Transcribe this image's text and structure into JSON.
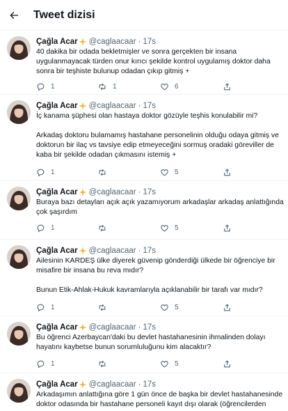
{
  "header": {
    "title": "Tweet dizisi",
    "back_icon": "arrow-left-icon"
  },
  "author": {
    "name": "Çağla Acar",
    "badge": "✨",
    "handle": "@caglaacaar",
    "separator": "·",
    "time": "17s"
  },
  "tweets": [
    {
      "lines": [
        "40 dakika bir odada bekletmişler ve sonra gerçekten bir insana",
        "uygulanmayacak türden onur kırıcı şekilde kontrol uygulamış doktor daha",
        "sonra bir teşhiste bulunup odadan çıkıp gitmiş +"
      ],
      "reply_count": "1",
      "retweet_count": "1",
      "like_count": "6"
    },
    {
      "lines": [
        "İç kanama şüphesi olan hastaya doktor gözüyle teşhis konulabilir mi?"
      ],
      "lines2": [
        "Arkadaş doktoru bulamamış hastahane personelinin olduğu odaya gitmiş ve",
        "doktorun bir ilaç vs tavsiye edip etmeyeceğini sormuş oradaki göreviller de",
        "kaba bir şekilde odadan çıkmasını istemiş +"
      ],
      "reply_count": "1",
      "retweet_count": "",
      "like_count": "5"
    },
    {
      "lines": [
        "Buraya bazı detayları açık açık yazamıyorum arkadaşlar arkadaş anlattığında",
        "çok şaşırdım"
      ],
      "reply_count": "1",
      "retweet_count": "",
      "like_count": "5"
    },
    {
      "lines": [
        "Ailesinin KARDEŞ ülke diyerek güvenip gönderdiği ülkede bir öğrenciye bir",
        "misafire bir insana bu reva mıdır?"
      ],
      "lines2": [
        "Bunun Etik-Ahlak-Hukuk kavramlarıyla açıklanabilir bir tarafı var mıdır?"
      ],
      "reply_count": "1",
      "retweet_count": "",
      "like_count": "5"
    },
    {
      "lines": [
        "Bu öğrenci Azerbaycan'daki bu devlet hastahanesinin ihmalinden dolayı",
        "hayatını kaybetse bunun sorumluluğunu kim alacaktır?"
      ],
      "reply_count": "1",
      "retweet_count": "",
      "like_count": "5"
    },
    {
      "lines": [
        "Arkadaşımın anlattığına göre 1 gün önce de başka bir devlet hastahanesinde",
        "doktor odasında bir hastahane personeli kayıt dışı olarak (öğrencilerden"
      ],
      "reply_count": "",
      "retweet_count": "",
      "like_count": ""
    }
  ]
}
